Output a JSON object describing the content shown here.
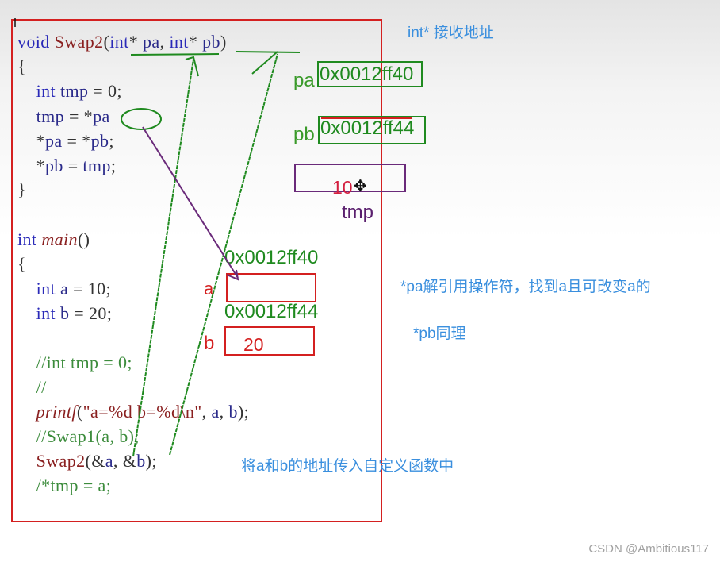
{
  "code": {
    "lines": [
      {
        "id": "l1",
        "parts": [
          [
            "kw",
            "void "
          ],
          [
            "fn",
            "Swap2"
          ],
          [
            "",
            "("
          ],
          [
            "kw",
            "int"
          ],
          [
            "",
            "* "
          ],
          [
            "var",
            "pa"
          ],
          [
            "",
            ", "
          ],
          [
            "kw",
            "int"
          ],
          [
            "",
            "* "
          ],
          [
            "var",
            "pb"
          ],
          [
            "",
            ")"
          ]
        ]
      },
      {
        "id": "l2",
        "parts": [
          [
            "",
            "{"
          ]
        ]
      },
      {
        "id": "l3",
        "parts": [
          [
            "",
            "    "
          ],
          [
            "kw",
            "int "
          ],
          [
            "var",
            "tmp"
          ],
          [
            "",
            " = 0;"
          ]
        ]
      },
      {
        "id": "l4",
        "parts": [
          [
            "",
            "    "
          ],
          [
            "var",
            "tmp"
          ],
          [
            "",
            " = *"
          ],
          [
            "var",
            "pa"
          ]
        ]
      },
      {
        "id": "l5",
        "parts": [
          [
            "",
            "    *"
          ],
          [
            "var",
            "pa"
          ],
          [
            "",
            " = *"
          ],
          [
            "var",
            "pb"
          ],
          [
            "",
            ";"
          ]
        ]
      },
      {
        "id": "l6",
        "parts": [
          [
            "",
            "    *"
          ],
          [
            "var",
            "pb"
          ],
          [
            "",
            " = "
          ],
          [
            "var",
            "tmp"
          ],
          [
            "",
            ";"
          ]
        ]
      },
      {
        "id": "l7",
        "parts": [
          [
            "",
            "}"
          ]
        ]
      },
      {
        "id": "l8",
        "parts": [
          [
            "kw",
            "int "
          ],
          [
            "it",
            "main"
          ],
          [
            "",
            "()"
          ]
        ]
      },
      {
        "id": "l9",
        "parts": [
          [
            "",
            "{"
          ]
        ]
      },
      {
        "id": "l10",
        "parts": [
          [
            "",
            "    "
          ],
          [
            "kw",
            "int "
          ],
          [
            "var",
            "a"
          ],
          [
            "",
            " = 10;"
          ]
        ]
      },
      {
        "id": "l11",
        "parts": [
          [
            "",
            "    "
          ],
          [
            "kw",
            "int "
          ],
          [
            "var",
            "b"
          ],
          [
            "",
            " = 20;"
          ]
        ]
      },
      {
        "id": "l12",
        "parts": [
          [
            "cm",
            "    //int tmp = 0;"
          ]
        ]
      },
      {
        "id": "l13",
        "parts": [
          [
            "cm",
            "    //"
          ]
        ]
      },
      {
        "id": "l14",
        "parts": [
          [
            "",
            "    "
          ],
          [
            "it",
            "printf"
          ],
          [
            "",
            "("
          ],
          [
            "st",
            "\"a=%d b=%d\\n\""
          ],
          [
            "",
            ", "
          ],
          [
            "var",
            "a"
          ],
          [
            "",
            ", "
          ],
          [
            "var",
            "b"
          ],
          [
            "",
            ");"
          ]
        ]
      },
      {
        "id": "l15",
        "parts": [
          [
            "cm",
            "    //Swap1(a, b);"
          ]
        ]
      },
      {
        "id": "l16",
        "parts": [
          [
            "",
            "    "
          ],
          [
            "fn",
            "Swap2"
          ],
          [
            "",
            "(&"
          ],
          [
            "var",
            "a"
          ],
          [
            "",
            ", &"
          ],
          [
            "var",
            "b"
          ],
          [
            "",
            ");"
          ]
        ]
      },
      {
        "id": "l17",
        "parts": [
          [
            "cm",
            "    /*tmp = a;"
          ]
        ]
      }
    ]
  },
  "annotations": {
    "receive_address": "int* 接收地址",
    "deref_explain": "*pa解引用操作符，找到a且可改变a的",
    "pb_same": "*pb同理",
    "pass_address": "将a和b的地址传入自定义函数中"
  },
  "memory": {
    "pa_label": "pa",
    "pa_value": "0x0012ff40",
    "pb_label": "pb",
    "pb_value": "0x0012ff44",
    "tmp_label": "tmp",
    "tmp_value": "10",
    "a_label": "a",
    "a_address": "0x0012ff40",
    "a_value": "",
    "b_label": "b",
    "b_address": "0x0012ff44",
    "b_value": "20"
  },
  "colors": {
    "frame": "#d42020",
    "pointer": "#1f8a1f",
    "deref_arrow": "#6a2a7a",
    "annotation": "#3a8fde"
  },
  "watermark": "CSDN @Ambitious117"
}
